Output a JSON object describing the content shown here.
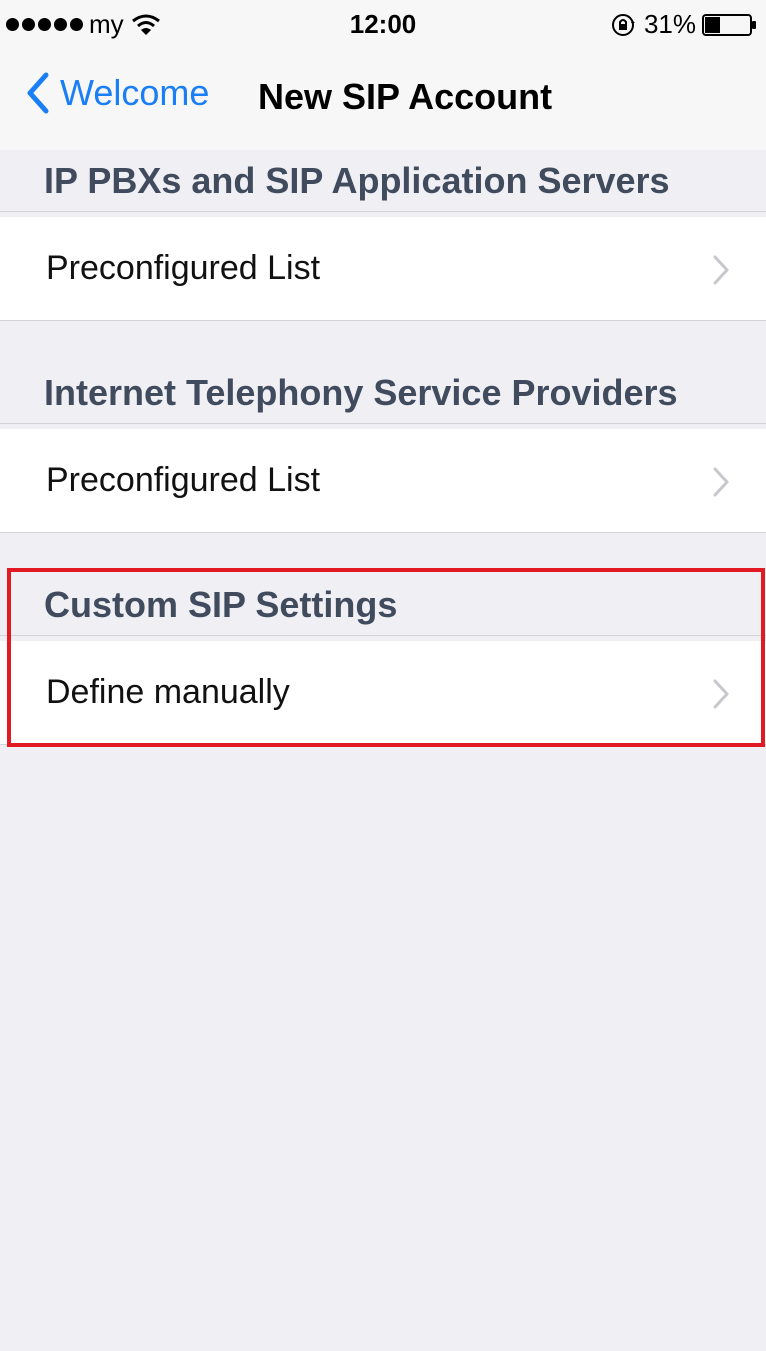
{
  "status_bar": {
    "carrier": "my",
    "time": "12:00",
    "battery_percent": "31%",
    "battery_level": 0.31,
    "icons": [
      "signal-dots-icon",
      "wifi-icon",
      "rotation-lock-icon",
      "battery-icon"
    ]
  },
  "nav": {
    "back_label": "Welcome",
    "title": "New SIP Account"
  },
  "sections": [
    {
      "header": "IP PBXs and SIP Application Servers",
      "item": "Preconfigured List"
    },
    {
      "header": "Internet Telephony Service Providers",
      "item": "Preconfigured List"
    },
    {
      "header": "Custom SIP Settings",
      "item": "Define manually"
    }
  ],
  "colors": {
    "accent_blue": "#1a7ef5",
    "highlight_red": "#e21a24",
    "background": "#efeff4",
    "section_header_text": "#414b5e"
  }
}
